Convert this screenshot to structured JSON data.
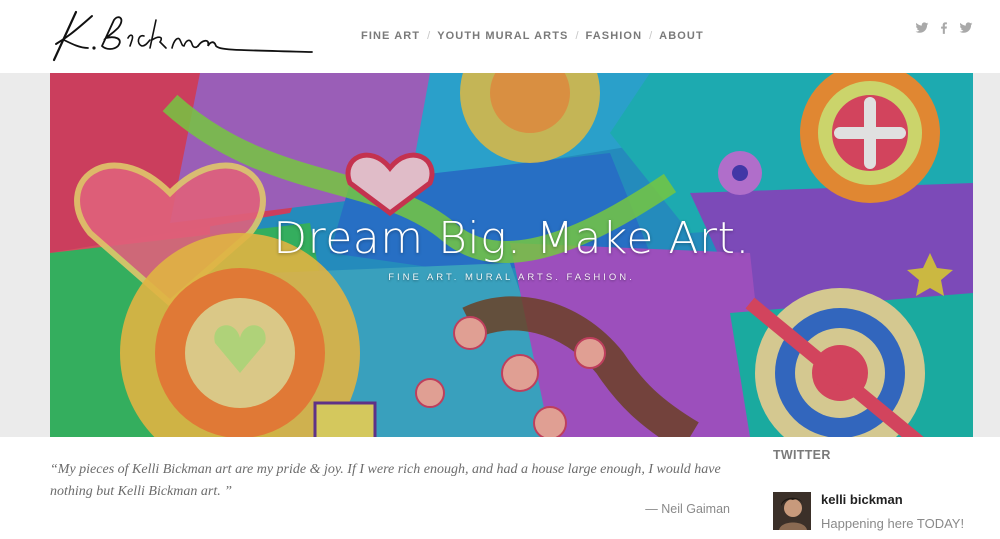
{
  "header": {
    "logo_name": "K. Bickman",
    "nav": [
      {
        "label": "FINE ART"
      },
      {
        "label": "YOUTH MURAL ARTS"
      },
      {
        "label": "FASHION"
      },
      {
        "label": "ABOUT"
      }
    ],
    "nav_separator": "/",
    "social": [
      "twitter-icon",
      "facebook-icon",
      "twitter-icon"
    ]
  },
  "hero": {
    "title": "Dream Big. Make Art.",
    "subtitle": "FINE ART. MURAL ARTS. FASHION."
  },
  "quote": {
    "text": "“My pieces of Kelli Bickman art are my pride & joy. If I were rich enough, and had a house large enough, I would have nothing but Kelli Bickman art. ”",
    "author": "— Neil Gaiman"
  },
  "twitter": {
    "heading": "TWITTER",
    "tweet": {
      "name": "kelli bickman",
      "text": "Happening here TODAY!"
    }
  },
  "colors": {
    "nav_text": "#7a7a7a",
    "band_background": "#ebebeb",
    "quote_text": "#6b6b6b"
  }
}
